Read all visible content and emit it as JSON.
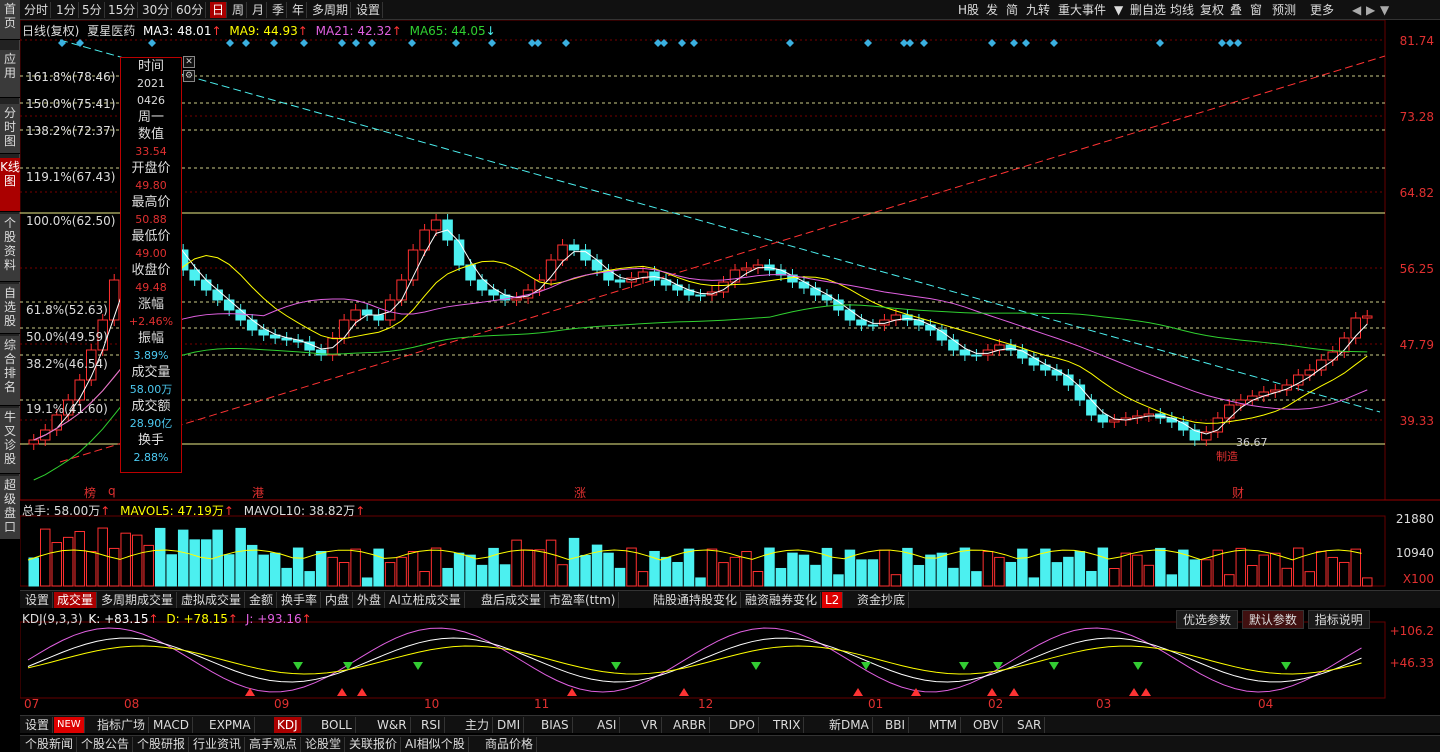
{
  "sidebar": [
    "首页",
    "应用",
    "分时图",
    "K线图",
    "个股资料",
    "自选股",
    "综合排名",
    "牛叉诊股",
    "超级盘口"
  ],
  "periods": [
    "分时",
    "1分",
    "5分",
    "15分",
    "30分",
    "60分",
    "日",
    "周",
    "月",
    "季",
    "年",
    "多周期",
    "设置"
  ],
  "active_period": "日",
  "right_tools": [
    "H股",
    "发",
    "简",
    "九转",
    "重大事件",
    "▼",
    "删自选",
    "均线",
    "复权",
    "叠",
    "窗",
    "预测",
    "更多"
  ],
  "legend": {
    "name": "日线(复权)",
    "stock": "夏星医药",
    "ma5": "MA3: 48.01",
    "ma9": "MA9: 44.93",
    "ma21": "MA21: 42.32",
    "ma65": "MA65: 44.05"
  },
  "price_axis": [
    "81.74",
    "73.28",
    "64.82",
    "56.25",
    "47.79",
    "39.33"
  ],
  "fib_levels": [
    "161.8%(78.46)",
    "150.0%(75.41)",
    "138.2%(72.37)",
    "119.1%(67.43)",
    "100.0%(62.50)",
    "61.8%(52.63)",
    "50.0%(49.59)",
    "38.2%(46.54)",
    "19.1%(41.60)"
  ],
  "low_label": "36.67",
  "low_note": "制造",
  "event_marks": [
    "榜",
    "q",
    "港",
    "涨",
    "财"
  ],
  "info": {
    "keys": [
      "时间",
      "周一",
      "数值",
      "开盘价",
      "最高价",
      "最低价",
      "收盘价",
      "涨幅",
      "振幅",
      "成交量",
      "成交额",
      "换手"
    ],
    "time1": "2021",
    "time2": "0426",
    "value": "33.54",
    "open": "49.80",
    "high": "50.88",
    "low": "49.00",
    "close": "49.48",
    "change": "+2.46%",
    "amplitude": "3.89%",
    "volume": "58.00万",
    "amount": "28.90亿",
    "turnover": "2.88%"
  },
  "vol_legend": {
    "total": "总手: 58.00万",
    "mavol5": "MAVOL5: 47.19万",
    "mavol10": "MAVOL10: 38.82万"
  },
  "vol_axis": [
    "21880",
    "10940",
    "X100"
  ],
  "ind_tabs": [
    "设置",
    "成交量",
    "多周期成交量",
    "虚拟成交量",
    "金额",
    "换手率",
    "内盘",
    "外盘",
    "AI立桩成交量",
    "盘后成交量",
    "市盈率(ttm)",
    "陆股通持股变化",
    "融资融券变化",
    "L2",
    "资金抄底"
  ],
  "active_ind_tab": "成交量",
  "kdj_legend": {
    "name": "KDJ(9,3,3)",
    "k": "K: +83.15",
    "d": "D: +78.15",
    "j": "J: +93.16"
  },
  "kdj_buttons": [
    "优选参数",
    "默认参数",
    "指标说明"
  ],
  "kdj_axis": [
    "+106.2",
    "+46.33"
  ],
  "months": [
    "07",
    "08",
    "09",
    "10",
    "11",
    "12",
    "01",
    "02",
    "03",
    "04"
  ],
  "indicator_tabs": [
    "设置",
    "NEW",
    "指标广场",
    "MACD",
    "EXPMA",
    "KDJ",
    "BOLL",
    "W&R",
    "RSI",
    "主力",
    "DMI",
    "BIAS",
    "ASI",
    "VR",
    "ARBR",
    "DPO",
    "TRIX",
    "新DMA",
    "BBI",
    "MTM",
    "OBV",
    "SAR"
  ],
  "active_indicator": "KDJ",
  "bottom_tabs": [
    "个股新闻",
    "个股公告",
    "个股研报",
    "行业资讯",
    "高手观点",
    "论股堂",
    "关联报价",
    "AI相似个股",
    "商品价格"
  ],
  "colors": {
    "up": "#ff3030",
    "down": "#4cf0f0",
    "ma3": "#ffffff",
    "ma9": "#ffff40",
    "ma21": "#e060e0",
    "ma65": "#30d030"
  }
}
